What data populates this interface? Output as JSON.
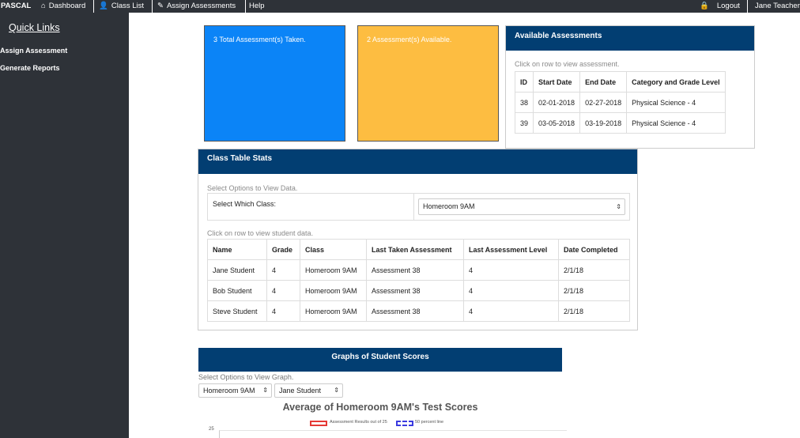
{
  "nav": {
    "brand": "PASCAL",
    "dashboard": "Dashboard",
    "class_list": "Class List",
    "assign": "Assign Assessments",
    "help": "Help",
    "logout": "Logout",
    "user": "Jane Teacher",
    "dashboard_icon": "home-icon",
    "class_list_icon": "user-icon",
    "assign_icon": "pencil-icon",
    "logout_icon": "lock-icon"
  },
  "sidebar": {
    "title": "Quick Links",
    "links": [
      "Assign Assessment",
      "Generate Reports"
    ]
  },
  "stats": {
    "total_taken": "3 Total Assessment(s) Taken.",
    "available": "2 Assessment(s) Available."
  },
  "available_assessments": {
    "title": "Available Assessments",
    "hint": "Click on row to view assessment.",
    "columns": [
      "ID",
      "Start Date",
      "End Date",
      "Category and Grade Level"
    ],
    "rows": [
      [
        "38",
        "02-01-2018",
        "02-27-2018",
        "Physical Science - 4"
      ],
      [
        "39",
        "03-05-2018",
        "03-19-2018",
        "Physical Science - 4"
      ]
    ]
  },
  "class_stats": {
    "title": "Class Table Stats",
    "select_hint": "Select Options to View Data.",
    "select_label": "Select Which Class:",
    "selected_class": "Homeroom 9AM",
    "row_hint": "Click on row to view student data.",
    "columns": [
      "Name",
      "Grade",
      "Class",
      "Last Taken Assessment",
      "Last Assessment Level",
      "Date Completed"
    ],
    "rows": [
      [
        "Jane Student",
        "4",
        "Homeroom 9AM",
        "Assessment 38",
        "4",
        "2/1/18"
      ],
      [
        "Bob Student",
        "4",
        "Homeroom 9AM",
        "Assessment 38",
        "4",
        "2/1/18"
      ],
      [
        "Steve Student",
        "4",
        "Homeroom 9AM",
        "Assessment 38",
        "4",
        "2/1/18"
      ]
    ]
  },
  "graphs": {
    "title": "Graphs of Student Scores",
    "hint": "Select Options to View Graph.",
    "class_select": "Homeroom 9AM",
    "student_select": "Jane Student",
    "chart_title": "Average of Homeroom 9AM's Test Scores",
    "legend_results": "Assessment Results out of 25",
    "legend_fifty": "50 percent line",
    "legend_results_color": "#e53935",
    "legend_fifty_color": "#3b3be0",
    "y_top_tick": "25"
  },
  "colors": {
    "nav_bg": "#2e3238",
    "panel_header": "#023e72",
    "blue_box": "#0b84f7",
    "yellow_box": "#fdbd41"
  }
}
